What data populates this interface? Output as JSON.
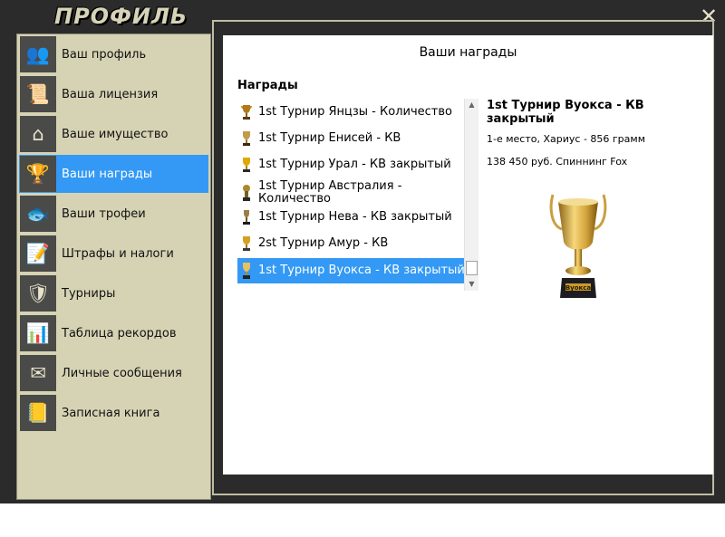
{
  "window": {
    "title": "ПРОФИЛЬ",
    "close_label": "✕"
  },
  "sidebar": {
    "items": [
      {
        "label": "Ваш профиль",
        "icon": "users-icon",
        "glyph": "👥",
        "active": false
      },
      {
        "label": "Ваша лицензия",
        "icon": "license-document-icon",
        "glyph": "📜",
        "active": false
      },
      {
        "label": "Ваше имущество",
        "icon": "house-icon",
        "glyph": "⌂",
        "active": false
      },
      {
        "label": "Ваши награды",
        "icon": "trophy-icon",
        "glyph": "🏆",
        "active": true
      },
      {
        "label": "Ваши трофеи",
        "icon": "fish-icon",
        "glyph": "🐟",
        "active": false
      },
      {
        "label": "Штрафы и налоги",
        "icon": "document-pen-icon",
        "glyph": "📝",
        "active": false
      },
      {
        "label": "Турниры",
        "icon": "shield-badge-icon",
        "glyph": "🛡",
        "active": false
      },
      {
        "label": "Таблица рекордов",
        "icon": "bar-chart-icon",
        "glyph": "📊",
        "active": false
      },
      {
        "label": "Личные сообщения",
        "icon": "envelope-icon",
        "glyph": "✉",
        "active": false
      },
      {
        "label": "Записная книга",
        "icon": "notebook-icon",
        "glyph": "📒",
        "active": false
      }
    ]
  },
  "panel": {
    "title": "Ваши награды",
    "awards_heading": "Награды",
    "awards": [
      {
        "label": "1st Турнир Янцзы - Количество",
        "icon": "trophy-icon",
        "selected": false
      },
      {
        "label": "1st Турнир Енисей - КВ",
        "icon": "trophy-icon",
        "selected": false
      },
      {
        "label": "1st Турнир Урал - КВ закрытый",
        "icon": "trophy-icon",
        "selected": false
      },
      {
        "label": "1st Турнир Австралия - Количество",
        "icon": "trophy-icon",
        "selected": false
      },
      {
        "label": "1st Турнир Нева - КВ закрытый",
        "icon": "trophy-icon",
        "selected": false
      },
      {
        "label": "2st Турнир Амур - КВ",
        "icon": "trophy-icon",
        "selected": false
      },
      {
        "label": "1st Турнир Вуокса - КВ закрытый",
        "icon": "trophy-icon",
        "selected": true
      }
    ],
    "detail": {
      "title": "1st Турнир Вуокса - КВ закрытый",
      "line1": "1-е место, Хариус - 856 грамм",
      "line2": "138 450 руб. Спиннинг Fox",
      "trophy_plate": "Вуокса"
    }
  },
  "colors": {
    "accent": "#3399f5",
    "sidebar_bg": "#d6d3b4",
    "frame_bg": "#2b2b2b"
  }
}
